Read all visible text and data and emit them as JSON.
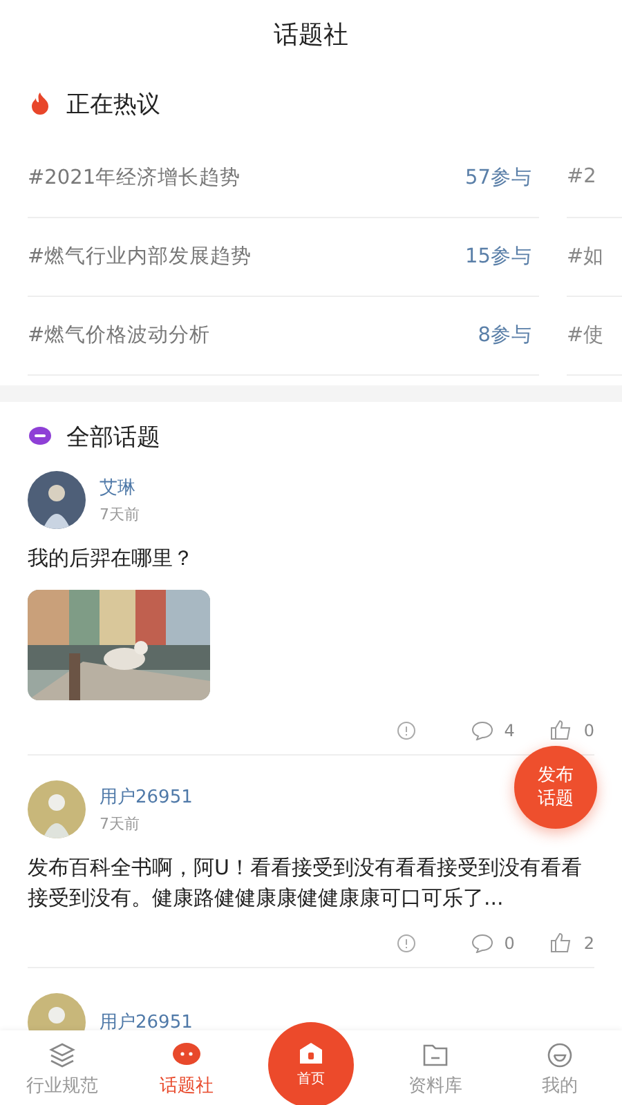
{
  "header": {
    "title": "话题社"
  },
  "hot": {
    "title": "正在热议",
    "topics": [
      {
        "title": "#2021年经济增长趋势",
        "count": "57参与"
      },
      {
        "title": "#燃气行业内部发展趋势",
        "count": "15参与"
      },
      {
        "title": "#燃气价格波动分析",
        "count": "8参与"
      }
    ],
    "next_column": [
      "#2",
      "#如",
      "#使"
    ]
  },
  "all": {
    "title": "全部话题",
    "posts": [
      {
        "user": "艾琳",
        "time": "7天前",
        "text": "我的后羿在哪里？",
        "comments": "4",
        "likes": "0"
      },
      {
        "kind": "text",
        "user": "用户26951",
        "time": "7天前",
        "text": "发布百科全书啊，阿U！看看接受到没有看看接受到没有看看接受到没有。健康路健健康康健健康康可口可乐了...",
        "comments": "0",
        "likes": "2"
      },
      {
        "kind": "partial",
        "user": "用户26951"
      }
    ]
  },
  "fab": [
    "发布",
    "话题"
  ],
  "tabs": [
    {
      "kind": "normal",
      "label": "行业规范",
      "selected": false
    },
    {
      "kind": "normal",
      "label": "话题社",
      "selected": true
    },
    {
      "kind": "center",
      "label": "首页",
      "selected": false
    },
    {
      "kind": "normal",
      "label": "资料库",
      "selected": false
    },
    {
      "kind": "normal",
      "label": "我的",
      "selected": false
    }
  ]
}
